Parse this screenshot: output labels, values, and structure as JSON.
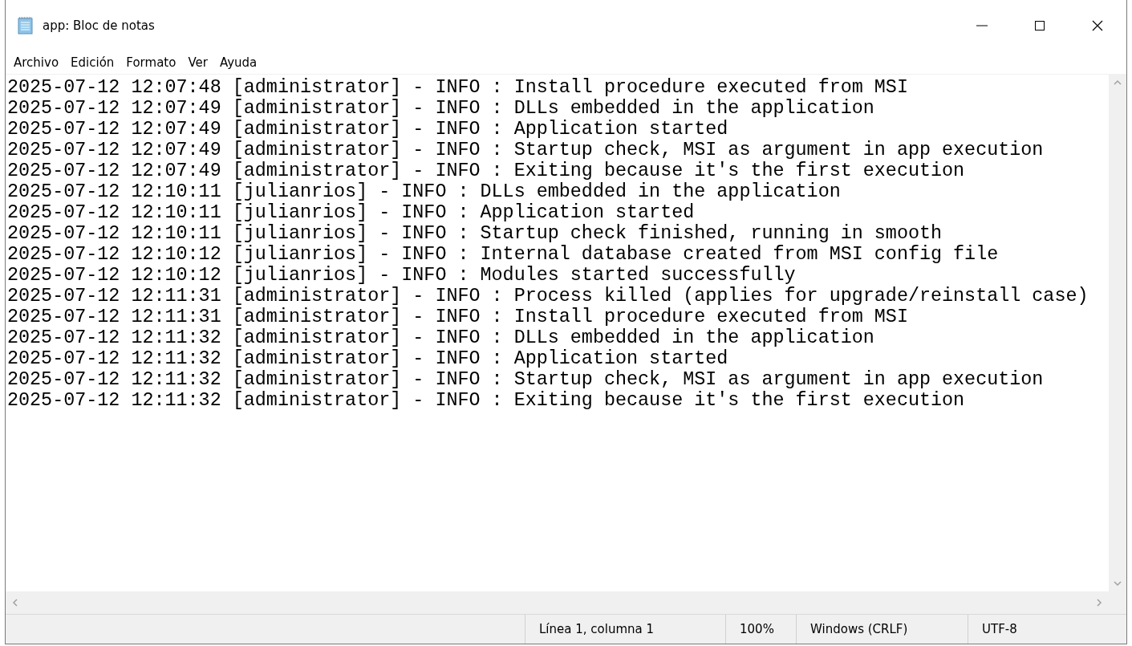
{
  "window": {
    "title": "app: Bloc de notas"
  },
  "menu": [
    "Archivo",
    "Edición",
    "Formato",
    "Ver",
    "Ayuda"
  ],
  "lines": [
    "2025-07-12 12:07:48 [administrator] - INFO : Install procedure executed from MSI",
    "2025-07-12 12:07:49 [administrator] - INFO : DLLs embedded in the application",
    "2025-07-12 12:07:49 [administrator] - INFO : Application started",
    "2025-07-12 12:07:49 [administrator] - INFO : Startup check, MSI as argument in app execution",
    "2025-07-12 12:07:49 [administrator] - INFO : Exiting because it's the first execution",
    "2025-07-12 12:10:11 [julianrios] - INFO : DLLs embedded in the application",
    "2025-07-12 12:10:11 [julianrios] - INFO : Application started",
    "2025-07-12 12:10:11 [julianrios] - INFO : Startup check finished, running in smooth",
    "2025-07-12 12:10:12 [julianrios] - INFO : Internal database created from MSI config file",
    "2025-07-12 12:10:12 [julianrios] - INFO : Modules started successfully",
    "2025-07-12 12:11:31 [administrator] - INFO : Process killed (applies for upgrade/reinstall case)",
    "2025-07-12 12:11:31 [administrator] - INFO : Install procedure executed from MSI",
    "2025-07-12 12:11:32 [administrator] - INFO : DLLs embedded in the application",
    "2025-07-12 12:11:32 [administrator] - INFO : Application started",
    "2025-07-12 12:11:32 [administrator] - INFO : Startup check, MSI as argument in app execution",
    "2025-07-12 12:11:32 [administrator] - INFO : Exiting because it's the first execution"
  ],
  "status_bar": [
    "Línea 1, columna 1",
    "100%",
    "Windows (CRLF)",
    "UTF-8"
  ]
}
